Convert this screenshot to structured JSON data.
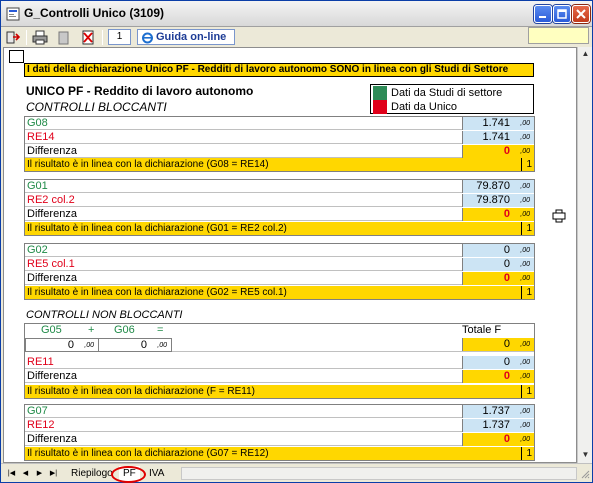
{
  "window": {
    "title": "G_Controlli Unico (3109)",
    "colors": {
      "accent_blue": "#2a5bd8",
      "gold": "#ffd700",
      "light_blue": "#cce4f4",
      "red": "#e0001a",
      "green": "#1f8a47"
    }
  },
  "toolbar": {
    "page_value": "1",
    "help_label": "Guida on-line",
    "icons": [
      "exit-icon",
      "print-icon",
      "copy-icon",
      "delete-icon",
      "ie-icon"
    ]
  },
  "banner": "I dati della dichiarazione Unico PF - Redditi di lavoro autonomo SONO  in linea con gli Studi di Settore",
  "header": {
    "title": "UNICO PF -  Reddito di lavoro autonomo",
    "subtitle": "CONTROLLI BLOCCANTI"
  },
  "legend": [
    {
      "label": "Dati da Studi di settore",
      "color": "#2e8b57"
    },
    {
      "label": "Dati da Unico",
      "color": "#e0001a"
    }
  ],
  "blocks": [
    {
      "rows": [
        {
          "label": "G08",
          "value": "1.741",
          "dec": ",00"
        },
        {
          "label": "RE14",
          "value": "1.741",
          "dec": ",00"
        },
        {
          "label": "Differenza",
          "value": "0",
          "dec": ",00"
        }
      ],
      "result": "Il risultato è in linea con la dichiarazione (G08 = RE14)",
      "flag": "1"
    },
    {
      "rows": [
        {
          "label": "G01",
          "value": "79.870",
          "dec": ",00"
        },
        {
          "label": "RE2 col.2",
          "value": "79.870",
          "dec": ",00"
        },
        {
          "label": "Differenza",
          "value": "0",
          "dec": ",00"
        }
      ],
      "result": "Il risultato è in linea con la dichiarazione (G01 = RE2 col.2)",
      "flag": "1"
    },
    {
      "rows": [
        {
          "label": "G02",
          "value": "0",
          "dec": ",00"
        },
        {
          "label": "RE5 col.1",
          "value": "0",
          "dec": ",00"
        },
        {
          "label": "Differenza",
          "value": "0",
          "dec": ",00"
        }
      ],
      "result": "Il risultato è in linea con la dichiarazione (G02 = RE5 col.1)",
      "flag": "1"
    }
  ],
  "non_blocking": {
    "subtitle": "CONTROLLI NON BLOCCANTI",
    "g05_label": "G05",
    "plus": "+",
    "g06_label": "G06",
    "eq": "=",
    "totale_label": "Totale F",
    "g05_value": "0",
    "g06_value": "0",
    "dec": ",00",
    "totale_value": "0",
    "rows": [
      {
        "label": "RE11",
        "value": "0",
        "dec": ",00"
      },
      {
        "label": "Differenza",
        "value": "0",
        "dec": ",00"
      }
    ],
    "result": "Il risultato è in linea con la dichiarazione (F = RE11)",
    "flag": "1"
  },
  "block_last": {
    "rows": [
      {
        "label": "G07",
        "value": "1.737",
        "dec": ",00"
      },
      {
        "label": "RE12",
        "value": "1.737",
        "dec": ",00"
      },
      {
        "label": "Differenza",
        "value": "0",
        "dec": ",00"
      }
    ],
    "result": "Il risultato è in linea con la dichiarazione (G07 = RE12)",
    "flag": "1"
  },
  "sheet_tabs": [
    "Riepilogo",
    "PF",
    "IVA"
  ]
}
